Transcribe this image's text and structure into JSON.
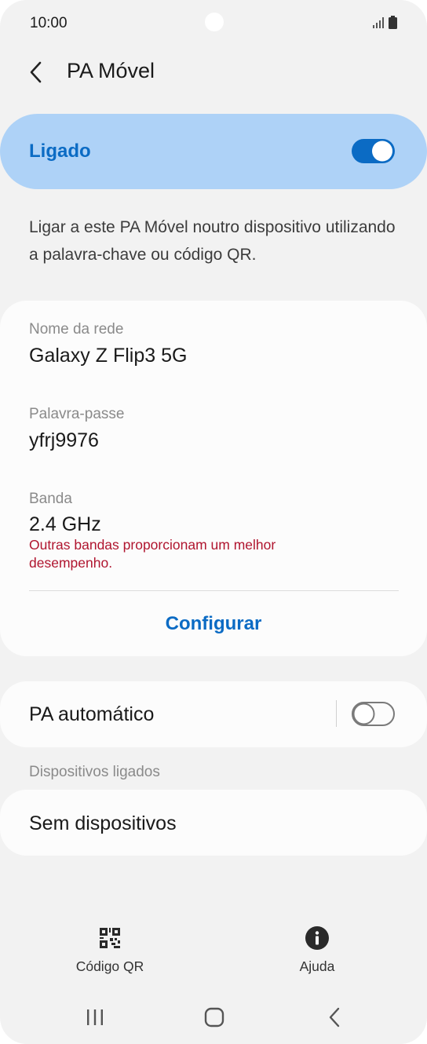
{
  "status_bar": {
    "time": "10:00",
    "signal_icon": "signal-icon",
    "battery_icon": "battery-icon"
  },
  "header": {
    "title": "PA Móvel",
    "back_icon": "back-arrow-icon"
  },
  "master_toggle": {
    "label": "Ligado",
    "state": "on",
    "accent": "#0b6bc4",
    "background": "#aed2f7"
  },
  "description": "Ligar a este PA Móvel noutro dispositivo utilizando a palavra-chave ou código QR.",
  "network": {
    "name_label": "Nome da rede",
    "name_value": "Galaxy Z Flip3 5G",
    "password_label": "Palavra-passe",
    "password_value": "yfrj9976",
    "band_label": "Banda",
    "band_value": "2.4 GHz",
    "band_warning": "Outras bandas proporcionam um melhor desempenho.",
    "warning_color": "#b0152f",
    "configure_label": "Configurar"
  },
  "auto_hotspot": {
    "label": "PA automático",
    "state": "off"
  },
  "connected_devices": {
    "header": "Dispositivos ligados",
    "empty_label": "Sem dispositivos"
  },
  "bottom_actions": {
    "qr_label": "Código QR",
    "qr_icon": "qr-code-icon",
    "help_label": "Ajuda",
    "help_icon": "info-icon"
  },
  "nav_bar": {
    "recents_icon": "recents-icon",
    "home_icon": "home-icon",
    "back_icon": "nav-back-icon"
  }
}
